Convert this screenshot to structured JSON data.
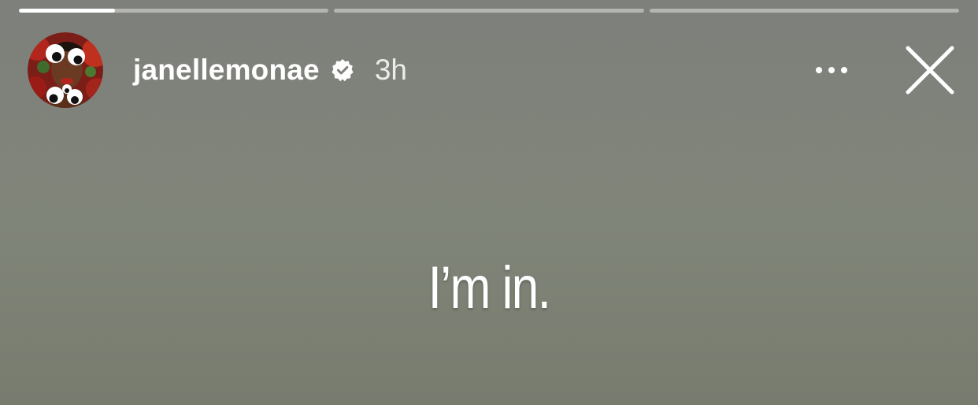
{
  "story": {
    "progress": [
      0.31,
      0,
      0
    ],
    "user": {
      "username": "janellemonae",
      "verified": true,
      "avatar_icon": "profile-avatar-googly-eyes",
      "timestamp": "3h"
    },
    "controls": {
      "more_icon": "more-horizontal-icon",
      "close_icon": "close-icon"
    },
    "text": "I’m in."
  },
  "colors": {
    "background_top": "#7e807b",
    "background_bottom": "#787c6f",
    "progress_track": "rgba(255,255,255,0.42)",
    "progress_fill": "#ffffff",
    "text": "#ffffff"
  }
}
